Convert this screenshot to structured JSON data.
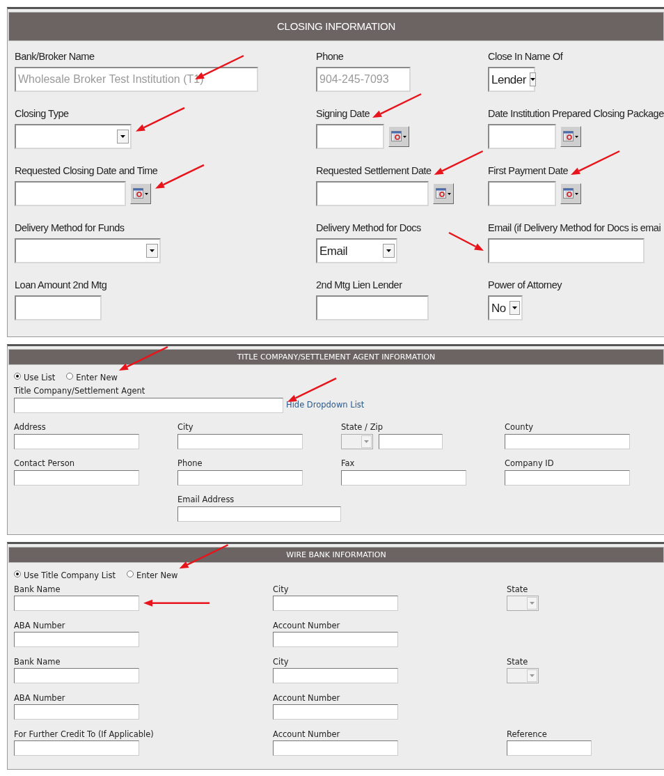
{
  "sections": [
    {
      "title": "CLOSING INFORMATION",
      "rows": [
        [
          {
            "label": "Bank/Broker Name",
            "kind": "text",
            "value": "Wholesale Broker Test Institution (T1)",
            "readonly": true,
            "arrow": true
          },
          {
            "label": "Phone",
            "kind": "text",
            "value": "904-245-7093",
            "readonly": true
          },
          {
            "label": "Close In Name Of",
            "kind": "select",
            "value": "Lender"
          }
        ],
        [
          {
            "label": "Closing Type",
            "kind": "select",
            "arrow": true
          },
          {
            "label": "Signing Date",
            "kind": "date",
            "arrow": true
          },
          {
            "label": "Date Institution Prepared Closing Package",
            "kind": "date"
          }
        ],
        [
          {
            "label": "Requested Closing Date and Time",
            "kind": "date",
            "arrow": true
          },
          {
            "label": "Requested Settlement Date",
            "kind": "date",
            "arrow": true
          },
          {
            "label": "First Payment Date",
            "kind": "date",
            "arrow": true
          }
        ],
        [
          {
            "label": "Delivery Method for Funds",
            "kind": "select"
          },
          {
            "label": "Delivery Method for Docs",
            "kind": "select",
            "value": "Email"
          },
          {
            "label": "Email (if Delivery Method for Docs is emai",
            "kind": "text",
            "arrow": true
          }
        ],
        [
          {
            "label": "Loan Amount 2nd Mtg",
            "kind": "text"
          },
          {
            "label": "2nd Mtg Lien Lender",
            "kind": "text"
          },
          {
            "label": "Power of Attorney",
            "kind": "select",
            "value": "No"
          }
        ]
      ]
    },
    {
      "title": "TITLE COMPANY/SETTLEMENT AGENT INFORMATION",
      "radios": [
        {
          "label": "Use List",
          "selected": true
        },
        {
          "label": "Enter New",
          "selected": false,
          "arrow": true
        }
      ],
      "lookup": {
        "label": "Title Company/Settlement Agent",
        "kind": "text",
        "link": "Hide Dropdown List",
        "arrow": true
      },
      "rows": [
        [
          {
            "label": "Address",
            "kind": "text"
          },
          {
            "label": "City",
            "kind": "text"
          },
          {
            "label": "State / Zip",
            "kind": "state-zip",
            "disabled": true
          },
          {
            "label": "County",
            "kind": "text"
          }
        ],
        [
          {
            "label": "Contact Person",
            "kind": "text"
          },
          {
            "label": "Phone",
            "kind": "text"
          },
          {
            "label": "Fax",
            "kind": "text"
          },
          {
            "label": "Company ID",
            "kind": "text"
          }
        ],
        [
          null,
          {
            "label": "Email Address",
            "kind": "text"
          }
        ]
      ]
    },
    {
      "title": "WIRE BANK INFORMATION",
      "radios": [
        {
          "label": "Use Title Company List",
          "selected": true
        },
        {
          "label": "Enter New",
          "selected": false,
          "arrow": true
        }
      ],
      "rows": [
        [
          {
            "label": "Bank Name",
            "kind": "text",
            "arrow": true
          },
          {
            "label": "City",
            "kind": "text"
          },
          {
            "label": "State",
            "kind": "select",
            "disabled": true
          }
        ],
        [
          {
            "label": "ABA Number",
            "kind": "text"
          },
          {
            "label": "Account Number",
            "kind": "text"
          }
        ],
        [
          {
            "label": "Bank Name",
            "kind": "text"
          },
          {
            "label": "City",
            "kind": "text"
          },
          {
            "label": "State",
            "kind": "select",
            "disabled": true
          }
        ],
        [
          {
            "label": "ABA Number",
            "kind": "text"
          },
          {
            "label": "Account Number",
            "kind": "text"
          }
        ],
        [
          {
            "label": "For Further Credit To (If Applicable)",
            "kind": "text"
          },
          {
            "label": "Account Number",
            "kind": "text"
          },
          {
            "label": "Reference",
            "kind": "text"
          }
        ]
      ]
    }
  ]
}
